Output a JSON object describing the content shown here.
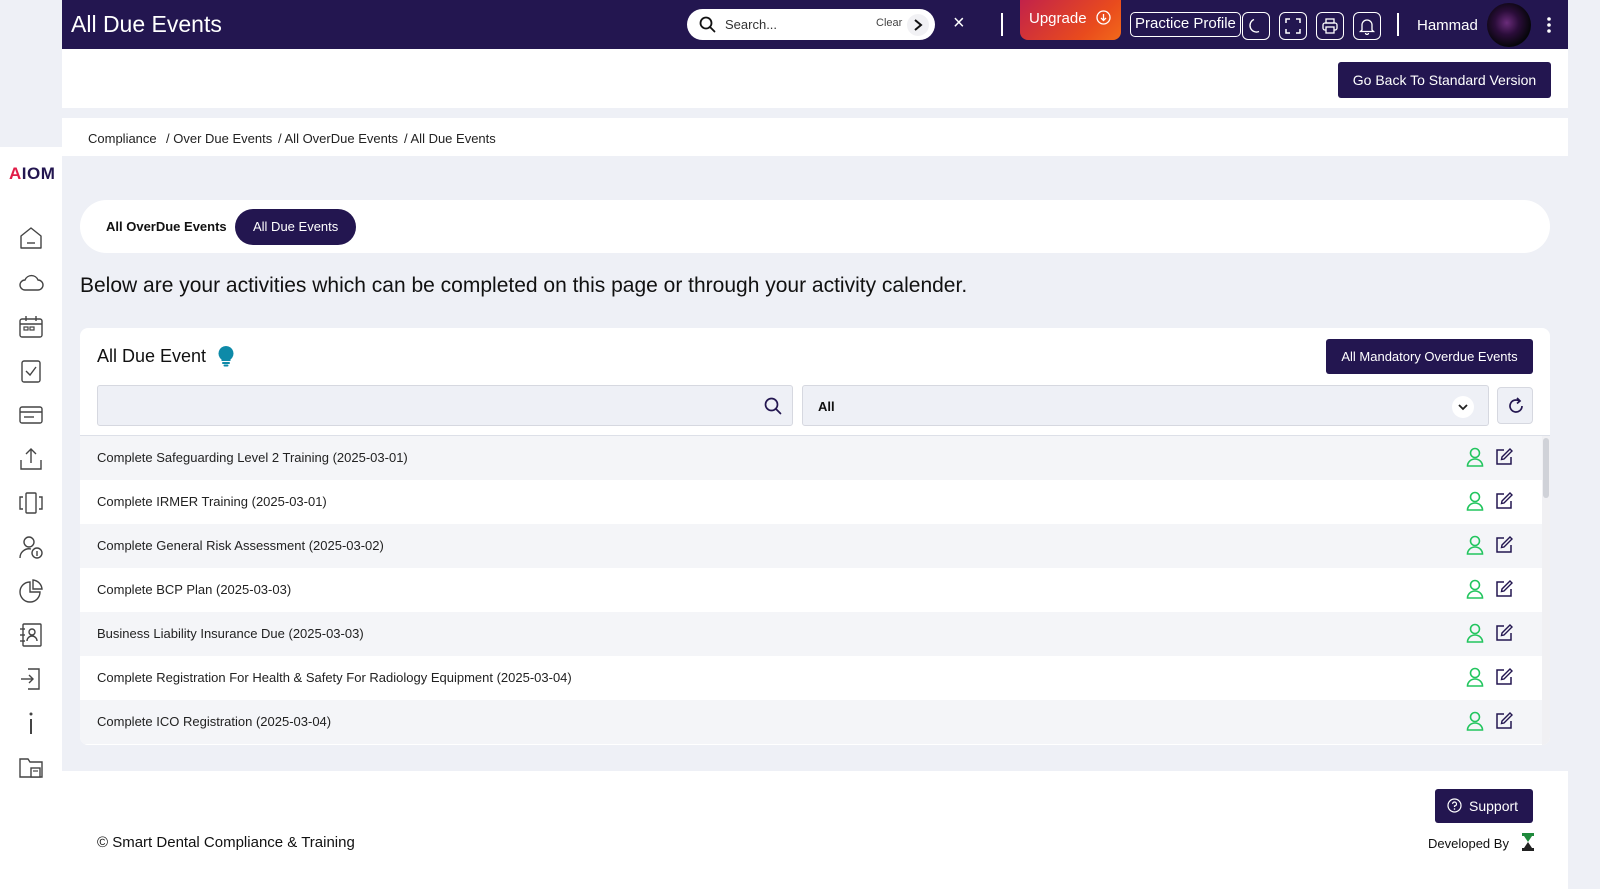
{
  "topbar": {
    "title": "All Due Events",
    "search_placeholder": "Search...",
    "clear_label": "Clear",
    "close_glyph": "×",
    "upgrade_label": "Upgrade",
    "practice_profile_label": "Practice Profile",
    "icons": [
      "moon-icon",
      "fullscreen-icon",
      "print-icon",
      "bell-icon"
    ],
    "username": "Hammad"
  },
  "subheader": {
    "go_back_label": "Go Back To Standard Version"
  },
  "breadcrumb": {
    "items": [
      "Compliance",
      "/ Over Due Events",
      "/ All OverDue Events",
      "/ All Due Events"
    ]
  },
  "sidebar": {
    "logo_prefix": "A",
    "logo_rest": "IOM",
    "icons": [
      "home-icon",
      "cloud-icon",
      "calendar-icon",
      "checklist-icon",
      "card-icon",
      "upload-icon",
      "carousel-icon",
      "user-info-icon",
      "pie-chart-icon",
      "contact-book-icon",
      "sign-in-icon",
      "info-icon",
      "folder-archive-icon"
    ]
  },
  "tabs": {
    "items": [
      {
        "label": "All OverDue Events",
        "active": false
      },
      {
        "label": "All Due Events",
        "active": true
      }
    ]
  },
  "intro_text": "Below are your activities which can be completed on this page or through your activity calender.",
  "card": {
    "title": "All Due Event",
    "mandatory_button_label": "All Mandatory Overdue Events",
    "filter_select_value": "All",
    "rows": [
      "Complete Safeguarding Level 2 Training (2025-03-01)",
      "Complete IRMER Training (2025-03-01)",
      "Complete General Risk Assessment (2025-03-02)",
      "Complete BCP Plan (2025-03-03)",
      "Business Liability Insurance Due (2025-03-03)",
      "Complete Registration For Health & Safety For Radiology Equipment (2025-03-04)",
      "Complete ICO Registration (2025-03-04)"
    ]
  },
  "footer": {
    "support_label": "Support",
    "copyright": "© Smart Dental Compliance & Training",
    "developed_by": "Developed By"
  },
  "colors": {
    "primary": "#231650",
    "accent_green": "#22c55e",
    "upgrade_gradient_start": "#c2224a",
    "upgrade_gradient_end": "#f2691a",
    "bulb": "#0e8aa8"
  }
}
